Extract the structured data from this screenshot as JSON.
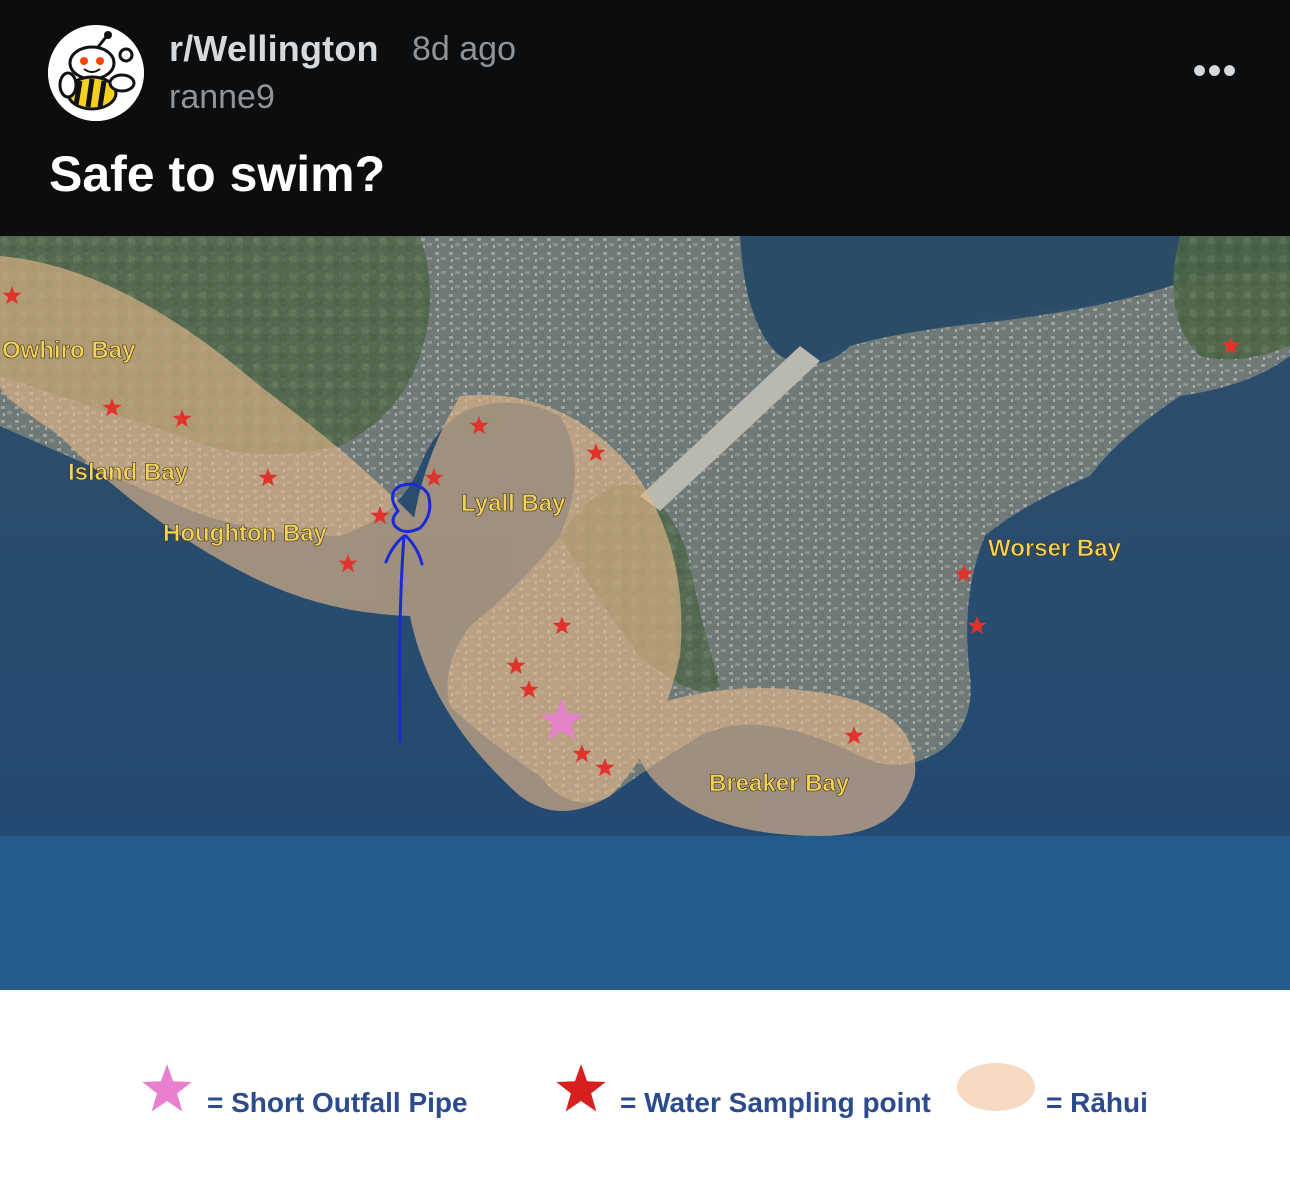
{
  "post": {
    "subreddit": "r/Wellington",
    "age": "8d ago",
    "username": "ranne9",
    "title": "Safe to swim?",
    "more_icon": "more-horizontal-icon",
    "more_glyph": "•••"
  },
  "map": {
    "labels": {
      "owhiro": "Owhiro Bay",
      "island": "Island Bay",
      "houghton": "Houghton Bay",
      "lyall": "Lyall Bay",
      "worser": "Worser Bay",
      "breaker": "Breaker Bay"
    }
  },
  "legend": {
    "outfall": "= Short Outfall Pipe",
    "sampling": "= Water Sampling point",
    "rahui": "= Rāhui"
  },
  "colors": {
    "background": "#0b0d0f",
    "rahui": "#e8b98a",
    "sampling_star": "#e0332b",
    "outfall_star": "#e97fcf",
    "legend_text": "#2b4b8c",
    "map_label": "#f2d35a",
    "drawing": "#1c2ad6"
  }
}
